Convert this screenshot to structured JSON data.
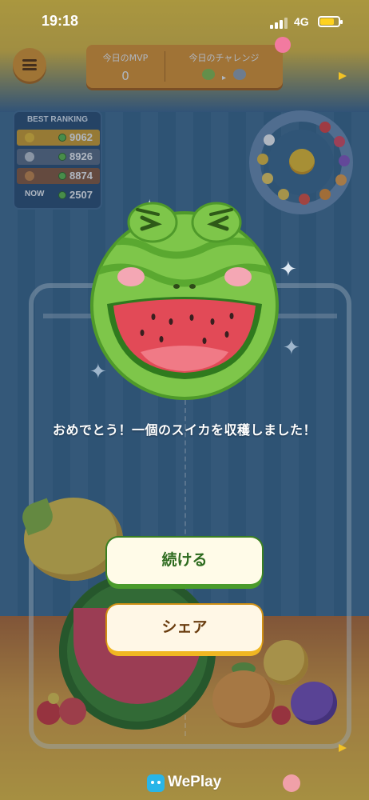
{
  "status_bar": {
    "time": "19:18",
    "network": "4G"
  },
  "header": {
    "mvp_label": "今日のMVP",
    "mvp_value": "0",
    "challenge_label": "今日のチャレンジ"
  },
  "ranking": {
    "title": "BEST RANKING",
    "rows": [
      {
        "rank": "1",
        "score": "9062",
        "medal_color": "#f5c431"
      },
      {
        "rank": "2",
        "score": "8926",
        "medal_color": "#c6ccd4"
      },
      {
        "rank": "3",
        "score": "8874",
        "medal_color": "#d28a46"
      },
      {
        "rank": "NOW",
        "score": "2507",
        "medal_color": ""
      }
    ]
  },
  "dialog": {
    "message": "おめでとう！一個のスイカを収穫しました！",
    "continue_label": "続ける",
    "share_label": "シェア"
  },
  "watermark": {
    "brand": "WePlay"
  },
  "colors": {
    "continue_shadow": "#4a9b2b",
    "share_shadow": "#f0b722",
    "melon_green": "#7ec64a",
    "melon_red": "#e24a57"
  }
}
